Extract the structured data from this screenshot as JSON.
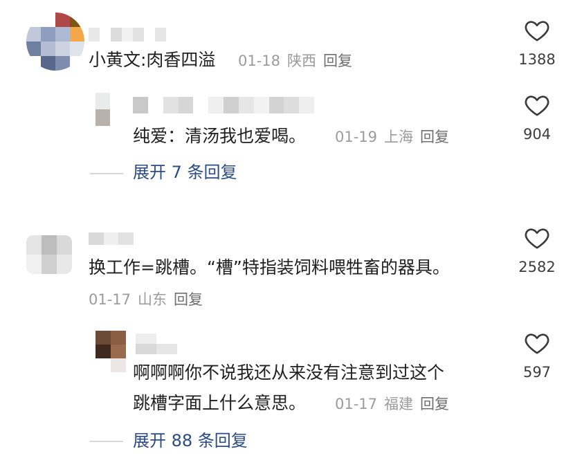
{
  "comments": [
    {
      "text": "小黄文:肉香四溢",
      "date": "01-18",
      "location": "陕西",
      "reply_label": "回复",
      "likes": "1388",
      "replies": [
        {
          "text": "纯爱：清汤我也爱喝。",
          "date": "01-19",
          "location": "上海",
          "reply_label": "回复",
          "likes": "904"
        }
      ],
      "expand_label": "展开 7 条回复"
    },
    {
      "text": "换工作=跳槽。“槽”特指装饲料喂牲畜的器具。",
      "date": "01-17",
      "location": "山东",
      "reply_label": "回复",
      "likes": "2582",
      "replies": [
        {
          "text_line1": "啊啊啊你不说我还从来没有注意到过这个",
          "text_line2": "跳槽字面上什么意思。",
          "date": "01-17",
          "location": "福建",
          "reply_label": "回复",
          "likes": "597"
        }
      ],
      "expand_label": "展开 88 条回复"
    }
  ],
  "icons": {
    "like": "heart-outline-icon"
  },
  "colors": {
    "expand_link": "#2b4a86",
    "meta": "#9b9b9b",
    "text": "#1f1f1f"
  }
}
